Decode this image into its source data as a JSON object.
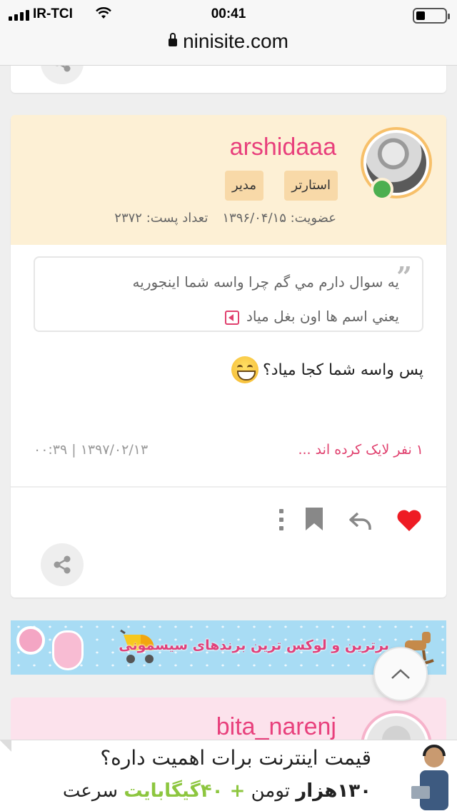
{
  "status_bar": {
    "carrier": "IR-TCI",
    "time": "00:41"
  },
  "browser": {
    "url": "ninisite.com"
  },
  "post": {
    "username": "arshidaaa",
    "badges": [
      "استارتر",
      "مدیر"
    ],
    "membership": "عضویت: ۱۳۹۶/۰۴/۱۵",
    "post_count": "تعداد پست: ۲۳۷۲",
    "quote_line1": "یه سوال دارم مي گم چرا واسه شما اینجوریه",
    "quote_line2": "يعني اسم ها اون بغل مياد",
    "body": "پس واسه شما کجا میاد؟",
    "likes": "۱ نفر لایک کرده اند ...",
    "date": "۰۰:۳۹ | ۱۳۹۷/۰۲/۱۳"
  },
  "banner": {
    "text": "برترین و لوکس ترین برندهای سیسمونی"
  },
  "post2": {
    "username": "bita_narenj"
  },
  "ad": {
    "line1": "قیمت اینترنت برات اهمیت داره؟",
    "line2_part1": "۱۳۰هزار",
    "line2_part2": " تومن ",
    "line2_part3": "+ ۴۰گیگابایت",
    "line2_part4": " سرعت"
  },
  "colors": {
    "accent_pink": "#e8407c",
    "header_bg": "#fdf0d5",
    "online": "#4caf50",
    "like_red": "#ee1c24"
  }
}
